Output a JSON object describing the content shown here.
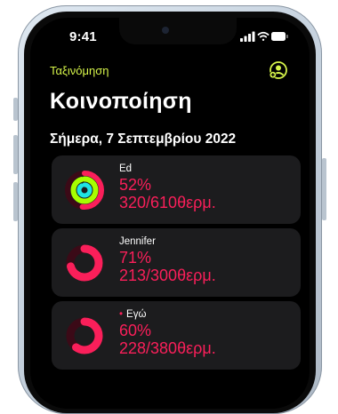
{
  "status": {
    "time": "9:41"
  },
  "nav": {
    "back_label": "Ταξινόμηση",
    "share_icon": "person-add-circle-icon"
  },
  "page": {
    "title": "Κοινοποίηση",
    "date_heading": "Σήμερα, 7 Σεπτεμβρίου 2022"
  },
  "colors": {
    "accent": "#d6f44a",
    "move": "#fa1f5a",
    "exercise": "#a6ff00",
    "stand": "#1ee4e2",
    "card_bg": "#1c1c1e"
  },
  "friends": [
    {
      "name": "Ed",
      "move_percent": "52%",
      "calories": "320/610θερμ.",
      "move_fraction": 0.52,
      "exercise_fraction": 0.95,
      "stand_fraction": 0.9,
      "is_me": false
    },
    {
      "name": "Jennifer",
      "move_percent": "71%",
      "calories": "213/300θερμ.",
      "move_fraction": 0.71,
      "is_me": false
    },
    {
      "name": "Εγώ",
      "move_percent": "60%",
      "calories": "228/380θερμ.",
      "move_fraction": 0.6,
      "is_me": true,
      "me_marker": "•"
    }
  ]
}
